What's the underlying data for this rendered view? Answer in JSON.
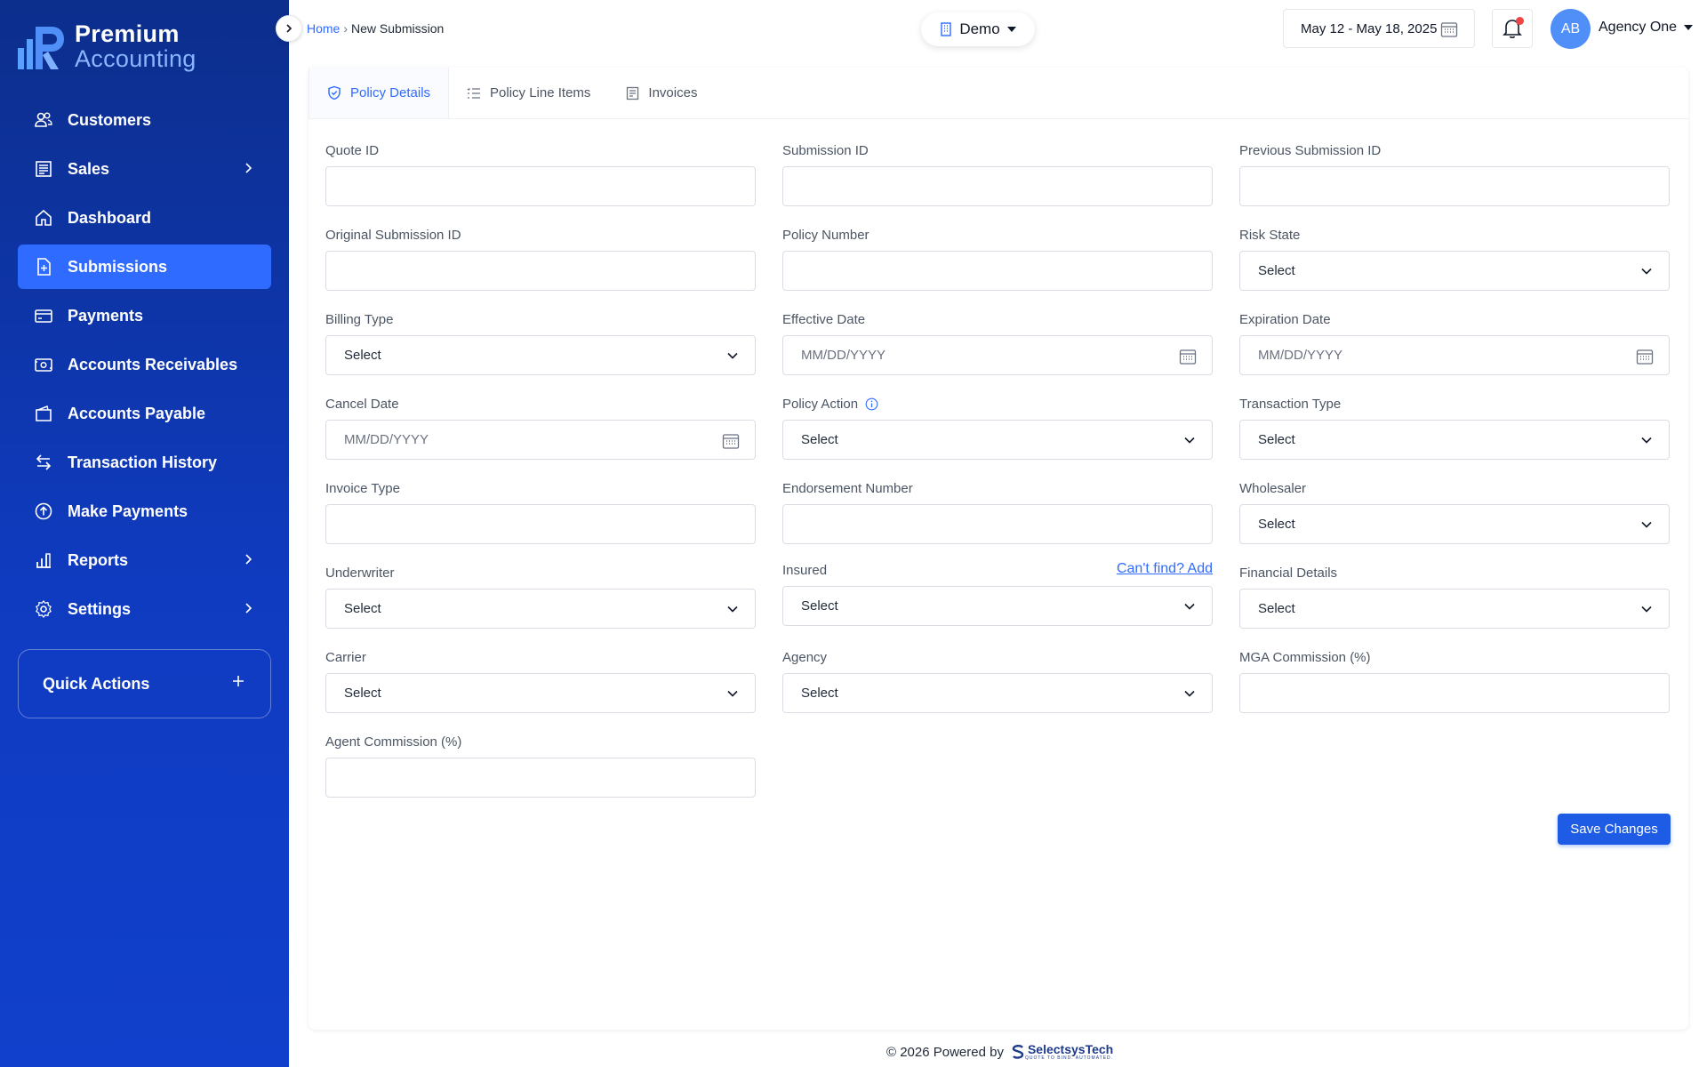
{
  "brand": {
    "line1": "Premium",
    "line2": "Accounting"
  },
  "sidebar": {
    "items": [
      {
        "label": "Customers",
        "icon": "users-icon",
        "chevron": false,
        "active": false
      },
      {
        "label": "Sales",
        "icon": "receipt-icon",
        "chevron": true,
        "active": false
      },
      {
        "label": "Dashboard",
        "icon": "home-icon",
        "chevron": false,
        "active": false
      },
      {
        "label": "Submissions",
        "icon": "file-plus-icon",
        "chevron": false,
        "active": true
      },
      {
        "label": "Payments",
        "icon": "credit-card-icon",
        "chevron": false,
        "active": false
      },
      {
        "label": "Accounts Receivables",
        "icon": "cash-icon",
        "chevron": false,
        "active": false
      },
      {
        "label": "Accounts Payable",
        "icon": "wallet-icon",
        "chevron": false,
        "active": false
      },
      {
        "label": "Transaction History",
        "icon": "arrows-exchange-icon",
        "chevron": false,
        "active": false
      },
      {
        "label": "Make Payments",
        "icon": "arrow-up-circle-icon",
        "chevron": false,
        "active": false
      },
      {
        "label": "Reports",
        "icon": "bar-chart-icon",
        "chevron": true,
        "active": false
      },
      {
        "label": "Settings",
        "icon": "gear-icon",
        "chevron": true,
        "active": false
      }
    ],
    "quick_actions": "Quick Actions"
  },
  "header": {
    "breadcrumb_home": "Home",
    "breadcrumb_sep": "›",
    "breadcrumb_current": "New Submission",
    "env": "Demo",
    "date_range": "May 12 - May 18, 2025",
    "avatar_initials": "AB",
    "agency": "Agency One"
  },
  "tabs": [
    {
      "label": "Policy Details",
      "icon": "shield-check-icon",
      "active": true
    },
    {
      "label": "Policy Line Items",
      "icon": "list-icon",
      "active": false
    },
    {
      "label": "Invoices",
      "icon": "invoice-icon",
      "active": false
    }
  ],
  "form": {
    "fields": [
      {
        "label": "Quote ID",
        "type": "text",
        "value": ""
      },
      {
        "label": "Submission ID",
        "type": "text",
        "value": ""
      },
      {
        "label": "Previous Submission ID",
        "type": "text",
        "value": ""
      },
      {
        "label": "Original Submission ID",
        "type": "text",
        "value": ""
      },
      {
        "label": "Policy Number",
        "type": "text",
        "value": ""
      },
      {
        "label": "Risk State",
        "type": "select",
        "value": "Select"
      },
      {
        "label": "Billing Type",
        "type": "select",
        "value": "Select"
      },
      {
        "label": "Effective Date",
        "type": "date",
        "value": "MM/DD/YYYY"
      },
      {
        "label": "Expiration Date",
        "type": "date",
        "value": "MM/DD/YYYY"
      },
      {
        "label": "Cancel Date",
        "type": "date",
        "value": "MM/DD/YYYY"
      },
      {
        "label": "Policy Action",
        "type": "select",
        "value": "Select",
        "info": true
      },
      {
        "label": "Transaction Type",
        "type": "select",
        "value": "Select"
      },
      {
        "label": "Invoice Type",
        "type": "text",
        "value": ""
      },
      {
        "label": "Endorsement Number",
        "type": "text",
        "value": ""
      },
      {
        "label": "Wholesaler",
        "type": "select",
        "value": "Select"
      },
      {
        "label": "Underwriter",
        "type": "select",
        "value": "Select"
      },
      {
        "label": "Insured",
        "type": "select",
        "value": "Select",
        "link": "Can't find? Add"
      },
      {
        "label": "Financial Details",
        "type": "select",
        "value": "Select"
      },
      {
        "label": "Carrier",
        "type": "select",
        "value": "Select"
      },
      {
        "label": "Agency",
        "type": "select",
        "value": "Select"
      },
      {
        "label": "MGA Commission (%)",
        "type": "text",
        "value": ""
      },
      {
        "label": "Agent Commission (%)",
        "type": "text",
        "value": ""
      }
    ],
    "save_label": "Save Changes"
  },
  "footer": {
    "copyright": "© 2026 Powered by",
    "company": "SelectsysTech",
    "tagline": "QUOTE TO BIND. AUTOMATED."
  },
  "colors": {
    "primary": "#2f6bff",
    "sidebar": "#0f3bc0",
    "button": "#1f5ce6",
    "alert": "#ef4444"
  }
}
